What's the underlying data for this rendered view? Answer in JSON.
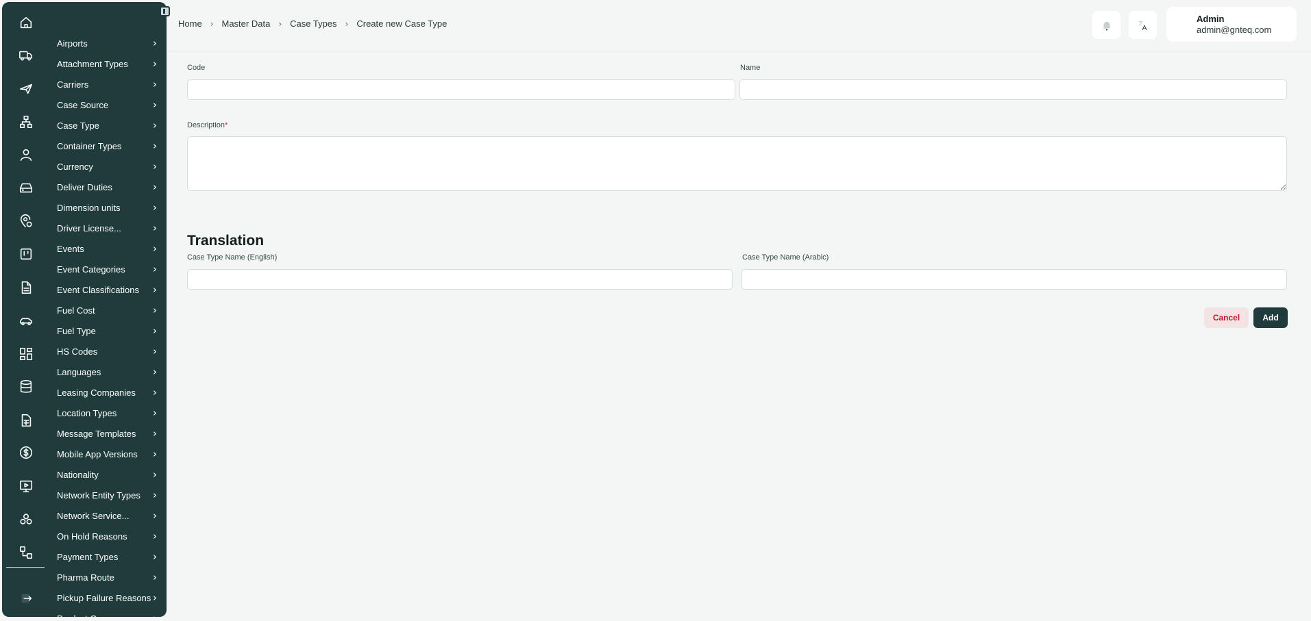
{
  "sidebar": {
    "rail_icons": [
      "home-icon",
      "truck-icon",
      "plane-icon",
      "network-icon",
      "user-icon",
      "hard-drive-icon",
      "map-pin-icon",
      "board-icon",
      "document-icon",
      "car-icon",
      "dashboard-icon",
      "database-icon",
      "spreadsheet-icon",
      "dollar-icon",
      "monitor-play-icon",
      "boxes-icon",
      "workflow-icon",
      "logout-icon"
    ],
    "items": [
      {
        "label": "Airports"
      },
      {
        "label": "Attachment Types"
      },
      {
        "label": "Carriers"
      },
      {
        "label": "Case Source"
      },
      {
        "label": "Case Type"
      },
      {
        "label": "Container Types"
      },
      {
        "label": "Currency"
      },
      {
        "label": "Deliver Duties"
      },
      {
        "label": "Dimension units"
      },
      {
        "label": "Driver License..."
      },
      {
        "label": "Events"
      },
      {
        "label": "Event Categories"
      },
      {
        "label": "Event Classifications"
      },
      {
        "label": "Fuel Cost"
      },
      {
        "label": "Fuel Type"
      },
      {
        "label": "HS Codes"
      },
      {
        "label": "Languages"
      },
      {
        "label": "Leasing Companies"
      },
      {
        "label": "Location Types"
      },
      {
        "label": "Message Templates"
      },
      {
        "label": "Mobile App Versions"
      },
      {
        "label": "Nationality"
      },
      {
        "label": "Network Entity Types"
      },
      {
        "label": "Network Service..."
      },
      {
        "label": "On Hold Reasons"
      },
      {
        "label": "Payment Types"
      },
      {
        "label": "Pharma Route"
      },
      {
        "label": "Pickup Failure Reasons"
      },
      {
        "label": "Product Groups"
      }
    ],
    "chevron": "›"
  },
  "breadcrumb": {
    "items": [
      "Home",
      "Master Data",
      "Case Types",
      "Create new Case Type"
    ],
    "separator": "›"
  },
  "header": {
    "notification_icon": "bell-icon",
    "language_icon": "translate-icon",
    "user_name": "Admin",
    "user_email": "admin@gnteq.com"
  },
  "form": {
    "code_label": "Code",
    "code_value": "",
    "name_label": "Name",
    "name_value": "",
    "description_label": "Description",
    "required_mark": "*",
    "description_value": ""
  },
  "translation": {
    "title": "Translation",
    "english_label": "Case Type Name  (English)",
    "english_value": "",
    "arabic_label": "Case Type Name  (Arabic)",
    "arabic_value": ""
  },
  "actions": {
    "cancel_label": "Cancel",
    "add_label": "Add"
  },
  "colors": {
    "sidebar_bg": "#1f3b3c",
    "page_bg": "#f4f6f6",
    "cancel_text": "#c4172a",
    "add_bg": "#1f3b3c"
  }
}
